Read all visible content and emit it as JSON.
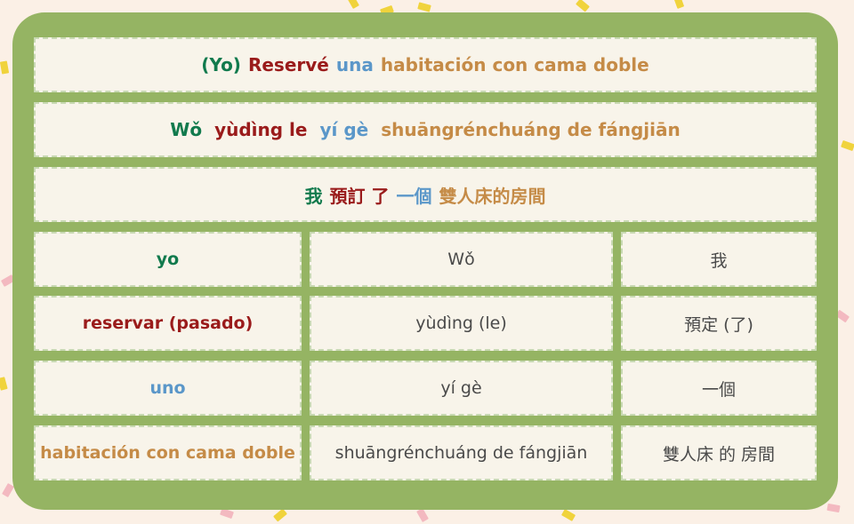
{
  "sentence": {
    "spanish": {
      "subject": "(Yo)",
      "verb": "Reservé",
      "article": "una",
      "object": "habitación con cama doble"
    },
    "pinyin": {
      "subject": "Wǒ",
      "verb": "yùdìng le",
      "article": "yí gè",
      "object": "shuāngrénchuáng de fángjiān"
    },
    "chinese": {
      "subject": "我",
      "verb": "預訂 了",
      "article": "一個",
      "object": "雙人床的房間"
    }
  },
  "vocab_rows": [
    {
      "spanish": "yo",
      "pinyin": "Wǒ",
      "chinese": "我"
    },
    {
      "spanish": "reservar (pasado)",
      "pinyin": "yùdìng (le)",
      "chinese": "預定 (了)"
    },
    {
      "spanish": "uno",
      "pinyin": "yí gè",
      "chinese": "一個"
    },
    {
      "spanish": "habitación con cama doble",
      "pinyin": "shuāngrénchuáng de fángjiān",
      "chinese": "雙人床 的 房間"
    }
  ],
  "colors": {
    "subject": "#117a4d",
    "verb": "#9a1b1b",
    "article": "#5b97c9",
    "object": "#c58b47",
    "board": "#95b463",
    "background": "#fbf0e6"
  }
}
